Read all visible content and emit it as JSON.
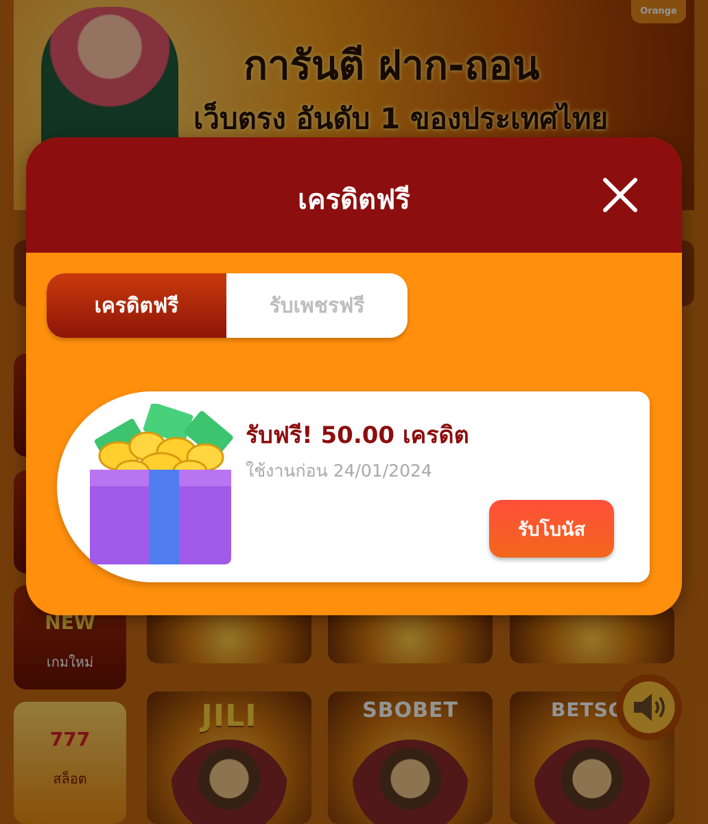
{
  "banner": {
    "headline": "การันตี ฝาก-ถอน",
    "subline": "เว็บตรง อันดับ 1 ของประเทศไทย",
    "logo_text": "Orange"
  },
  "sidebar": {
    "items": [
      {
        "label": "เกมใหม่",
        "badge": "NEW"
      },
      {
        "label": "สล็อต",
        "badge": "777"
      }
    ]
  },
  "providers": [
    {
      "name": "JILI"
    },
    {
      "name": "SBOBET"
    },
    {
      "name": "BETSOFT"
    }
  ],
  "modal": {
    "title": "เครดิตฟรี",
    "tabs": [
      {
        "label": "เครดิตฟรี",
        "active": true
      },
      {
        "label": "รับเพชรฟรี",
        "active": false
      }
    ],
    "offer": {
      "title": "รับฟรี! 50.00 เครดิต",
      "expiry": "ใช้งานก่อน 24/01/2024",
      "button_label": "รับโบนัส"
    }
  },
  "colors": {
    "header": "#8c0e0e",
    "modal_body": "#ff8f0d",
    "claim_button": "#f5522c"
  }
}
